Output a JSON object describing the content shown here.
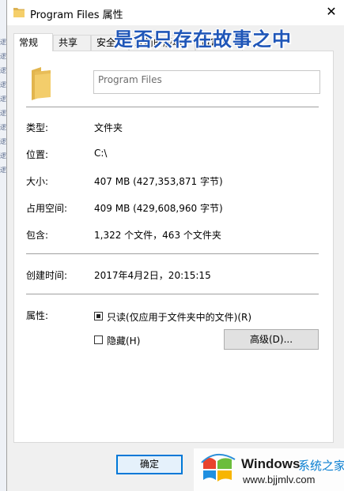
{
  "window": {
    "title": "Program Files 属性",
    "close_glyph": "✕"
  },
  "overlay": {
    "text": "是否只存在故事之中"
  },
  "tabs": [
    {
      "label": "常规",
      "active": true
    },
    {
      "label": "共享",
      "active": false
    },
    {
      "label": "安全",
      "active": false
    },
    {
      "label": "以前的版本",
      "active": false
    },
    {
      "label": "自定义",
      "active": false
    }
  ],
  "general": {
    "name_value": "Program Files",
    "type_label": "类型:",
    "type_value": "文件夹",
    "location_label": "位置:",
    "location_value": "C:\\",
    "size_label": "大小:",
    "size_value": "407 MB (427,353,871 字节)",
    "disk_label": "占用空间:",
    "disk_value": "409 MB (429,608,960 字节)",
    "contains_label": "包含:",
    "contains_value": "1,322 个文件，463 个文件夹",
    "created_label": "创建时间:",
    "created_value": "2017年4月2日，20:15:15",
    "attributes_label": "属性:",
    "readonly_label": "只读(仅应用于文件夹中的文件)(R)",
    "readonly_state": "indeterminate",
    "hidden_label": "隐藏(H)",
    "hidden_state": "unchecked",
    "advanced_label": "高级(D)..."
  },
  "footer": {
    "ok_label": "确定"
  },
  "watermark": {
    "brand": "Windows",
    "cn": "系统之家",
    "url": "www.bjjmlv.com"
  },
  "left_strip_glyphs": [
    "逻",
    "逻",
    "逻",
    "逻",
    "逻",
    "逻",
    "逻",
    "逻",
    "逻",
    "逻"
  ]
}
